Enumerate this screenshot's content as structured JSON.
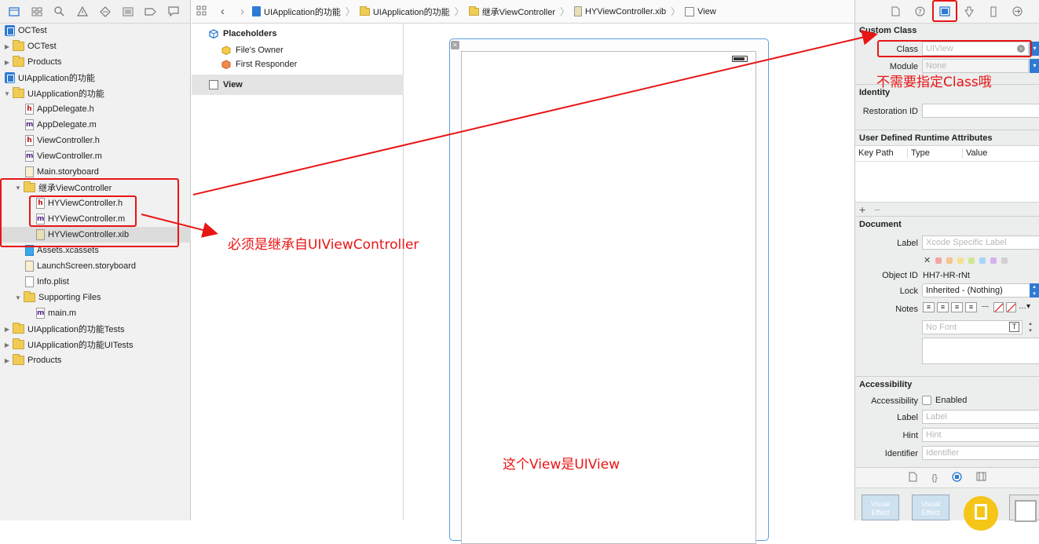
{
  "navigator": {
    "rows": [
      {
        "label": "OCTest",
        "kind": "proj",
        "tri": "",
        "indent": 6
      },
      {
        "label": "OCTest",
        "kind": "folder",
        "tri": "▶",
        "indent": 4
      },
      {
        "label": "Products",
        "kind": "folder",
        "tri": "▶",
        "indent": 4
      },
      {
        "label": "UIApplication的功能",
        "kind": "proj",
        "tri": "",
        "indent": 6
      },
      {
        "label": "UIApplication的功能",
        "kind": "folder",
        "tri": "▼",
        "indent": 4
      },
      {
        "label": "AppDelegate.h",
        "kind": "h",
        "tri": "",
        "indent": 32
      },
      {
        "label": "AppDelegate.m",
        "kind": "m",
        "tri": "",
        "indent": 32
      },
      {
        "label": "ViewController.h",
        "kind": "h",
        "tri": "",
        "indent": 32
      },
      {
        "label": "ViewController.m",
        "kind": "m",
        "tri": "",
        "indent": 32
      },
      {
        "label": "Main.storyboard",
        "kind": "sb",
        "tri": "",
        "indent": 32
      },
      {
        "label": "继承ViewController",
        "kind": "folder",
        "tri": "▼",
        "indent": 18
      },
      {
        "label": "HYViewController.h",
        "kind": "h",
        "tri": "",
        "indent": 46
      },
      {
        "label": "HYViewController.m",
        "kind": "m",
        "tri": "",
        "indent": 46
      },
      {
        "label": "HYViewController.xib",
        "kind": "xib",
        "tri": "",
        "indent": 46
      },
      {
        "label": "Assets.xcassets",
        "kind": "xc",
        "tri": "",
        "indent": 32
      },
      {
        "label": "LaunchScreen.storyboard",
        "kind": "sb",
        "tri": "",
        "indent": 32
      },
      {
        "label": "Info.plist",
        "kind": "pl",
        "tri": "",
        "indent": 32
      },
      {
        "label": "Supporting Files",
        "kind": "folder",
        "tri": "▼",
        "indent": 18
      },
      {
        "label": "main.m",
        "kind": "m",
        "tri": "",
        "indent": 46
      },
      {
        "label": "UIApplication的功能Tests",
        "kind": "folder",
        "tri": "▶",
        "indent": 4
      },
      {
        "label": "UIApplication的功能UITests",
        "kind": "folder",
        "tri": "▶",
        "indent": 4
      },
      {
        "label": "Products",
        "kind": "folder",
        "tri": "▶",
        "indent": 4
      }
    ],
    "file_letters": {
      "h": "h",
      "m": "m",
      "sb": "",
      "xib": "",
      "xc": "",
      "pl": ""
    }
  },
  "breadcrumb": {
    "items": [
      "UIApplication的功能",
      "UIApplication的功能",
      "继承ViewController",
      "HYViewController.xib",
      "View"
    ]
  },
  "document_outline": {
    "placeholders": "Placeholders",
    "files_owner": "File's Owner",
    "first_responder": "First Responder",
    "view": "View"
  },
  "inspector": {
    "custom_class": {
      "title": "Custom Class",
      "class_label": "Class",
      "class_placeholder": "UIView",
      "module_label": "Module",
      "module_placeholder": "None"
    },
    "identity": {
      "title": "Identity",
      "restoration_label": "Restoration ID"
    },
    "udra": {
      "title": "User Defined Runtime Attributes",
      "col_keypath": "Key Path",
      "col_type": "Type",
      "col_value": "Value",
      "add": "+",
      "remove": "−"
    },
    "document": {
      "title": "Document",
      "label_label": "Label",
      "label_placeholder": "Xcode Specific Label",
      "object_id_label": "Object ID",
      "object_id": "HH7-HR-rNt",
      "lock_label": "Lock",
      "lock_value": "Inherited - (Nothing)",
      "notes_label": "Notes",
      "font_placeholder": "No Font",
      "swatch_colors": [
        "#f2a5a5",
        "#f6c48e",
        "#f4e18d",
        "#cfe88d",
        "#a8d4f5",
        "#d3b2ec",
        "#d0d0d0"
      ]
    },
    "accessibility": {
      "title": "Accessibility",
      "accessibility_label": "Accessibility",
      "enabled_label": "Enabled",
      "label_label": "Label",
      "label_placeholder": "Label",
      "hint_label": "Hint",
      "hint_placeholder": "Hint",
      "identifier_label": "Identifier",
      "identifier_placeholder": "Identifier"
    },
    "library_items": [
      "Visual Effect",
      "Visual Effect"
    ]
  },
  "annotations": {
    "class_note": "不需要指定Class哦",
    "inherit_note": "必须是继承自UIViewController",
    "view_note": "这个View是UIView"
  },
  "colors": {
    "annotation": "#e81515",
    "accent": "#2d7bd3"
  }
}
